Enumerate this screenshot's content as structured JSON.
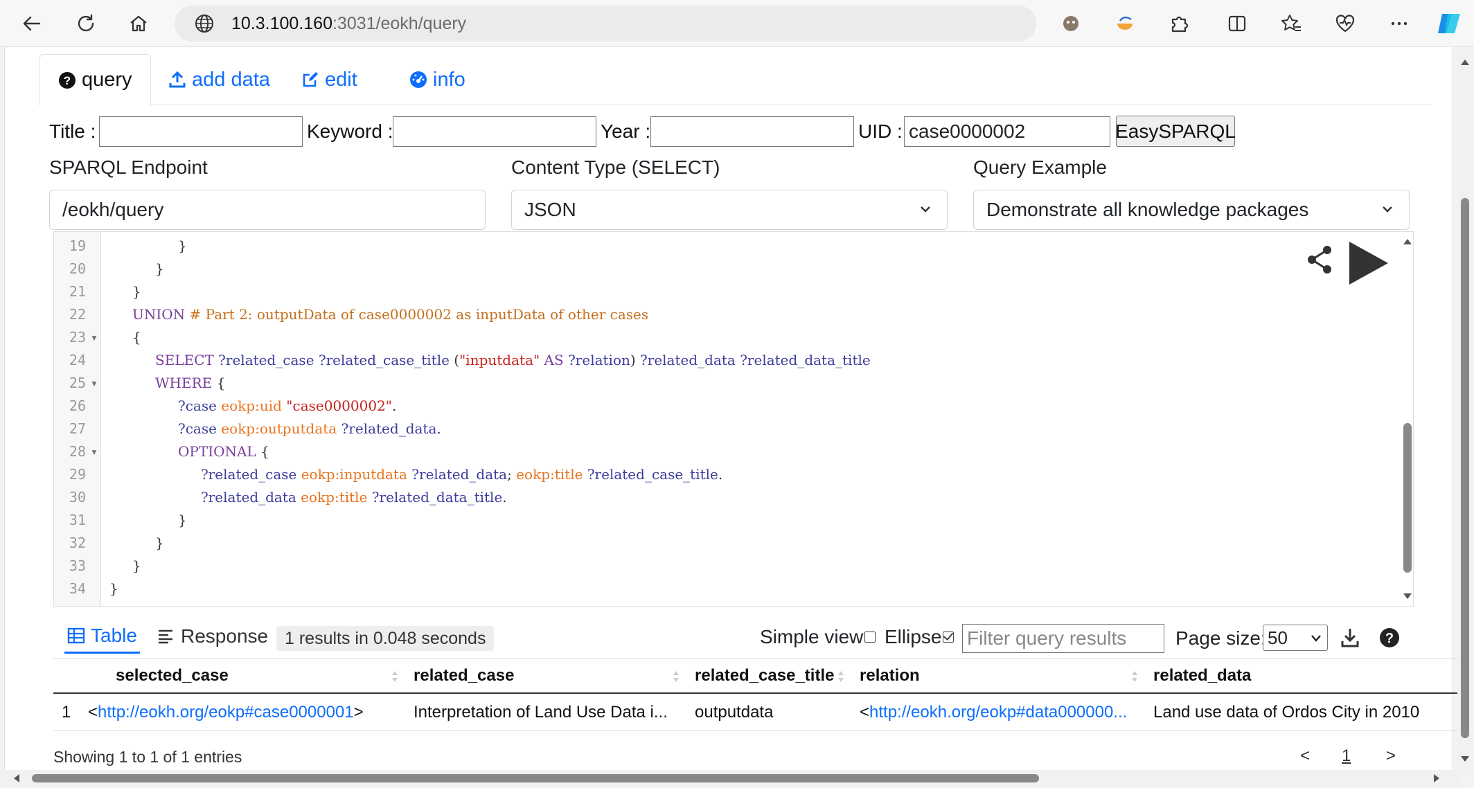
{
  "browser": {
    "url_host": "10.3.100.160",
    "url_path": ":3031/eokh/query"
  },
  "tabs": [
    {
      "label": "query",
      "icon": "question-circle-icon"
    },
    {
      "label": "add data",
      "icon": "upload-icon"
    },
    {
      "label": "edit",
      "icon": "edit-icon"
    },
    {
      "label": "info",
      "icon": "dashboard-icon"
    }
  ],
  "easy": {
    "title_label": "Title :",
    "keyword_label": "Keyword :",
    "year_label": "Year :",
    "uid_label": "UID :",
    "uid_value": "case0000002",
    "button_label": "EasySPARQL"
  },
  "config": {
    "endpoint_label": "SPARQL Endpoint",
    "endpoint_value": "/eokh/query",
    "content_type_label": "Content Type (SELECT)",
    "content_type_value": "JSON",
    "example_label": "Query Example",
    "example_value": "Demonstrate all knowledge packages"
  },
  "editor": {
    "line_numbers": [
      "19",
      "20",
      "21",
      "22",
      "23",
      "24",
      "25",
      "26",
      "27",
      "28",
      "29",
      "30",
      "31",
      "32",
      "33",
      "34"
    ]
  },
  "results": {
    "tab_table": "Table",
    "tab_response": "Response",
    "count_text": "1 results in 0.048 seconds",
    "simple_view_label": "Simple view",
    "ellipse_label": "Ellipse",
    "filter_placeholder": "Filter query results",
    "page_size_label": "Page size:",
    "page_size_value": "50",
    "columns": [
      "selected_case",
      "related_case",
      "related_case_title",
      "relation",
      "related_data"
    ],
    "row": {
      "index": "1",
      "selected_case_prefix": "<",
      "selected_case_link": "http://eokh.org/eokp#case0000001",
      "selected_case_suffix": ">",
      "related_case": "Interpretation of Land Use Data i...",
      "related_case_title": "outputdata",
      "relation_prefix": "<",
      "relation_link": "http://eokh.org/eokp#data000000...",
      "related_data": "Land use data of Ordos City in 2010"
    },
    "showing": "Showing 1 to 1 of 1 entries",
    "pager_prev": "<",
    "pager_page": "1",
    "pager_next": ">"
  }
}
